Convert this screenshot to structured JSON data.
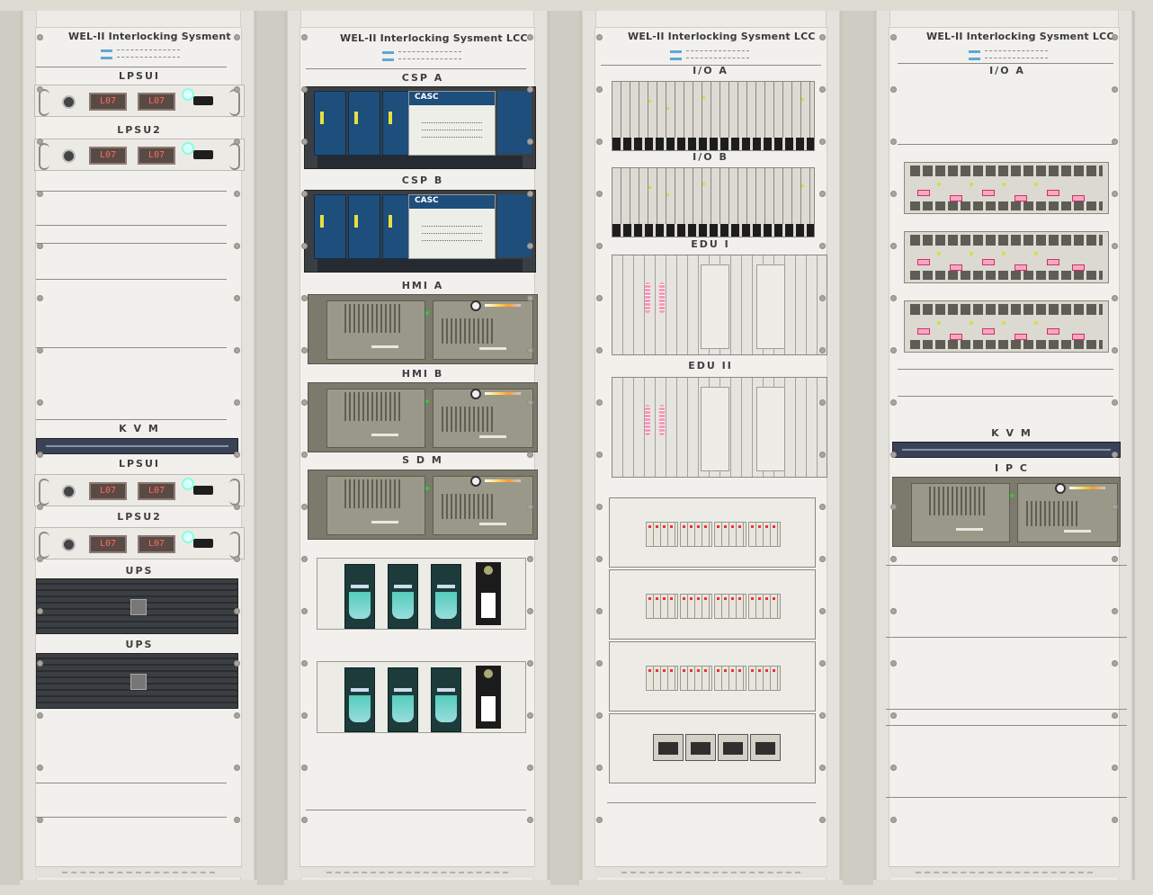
{
  "racks": [
    {
      "title": "WEL-II  Interlocking  Sysment",
      "labels": {
        "lpsu1_a": "LPSUI",
        "lpsu2_a": "LPSU2",
        "kvm": "K V M",
        "lpsu1_b": "LPSUI",
        "lpsu2_b": "LPSU2",
        "ups_a": "UPS",
        "ups_b": "UPS"
      },
      "display_value": "L07"
    },
    {
      "title": "WEL-II  Interlocking  Sysment LCC",
      "labels": {
        "csp_a": "CSP   A",
        "csp_b": "CSP   B",
        "hmi_a": "HMI   A",
        "hmi_b": "HMI   B",
        "sdm": "S  D  M"
      },
      "csp_brand": "CASC"
    },
    {
      "title": "WEL-II  Interlocking  Sysment LCC",
      "labels": {
        "io_a": "I/O   A",
        "io_b": "I/O   B",
        "edu_1": "EDU   I",
        "edu_2": "EDU   II"
      }
    },
    {
      "title": "WEL-II  Interlocking  Sysment LCC",
      "labels": {
        "io_a": "I/O   A",
        "kvm": "K  V  M",
        "ipc": "I  P  C"
      }
    }
  ]
}
